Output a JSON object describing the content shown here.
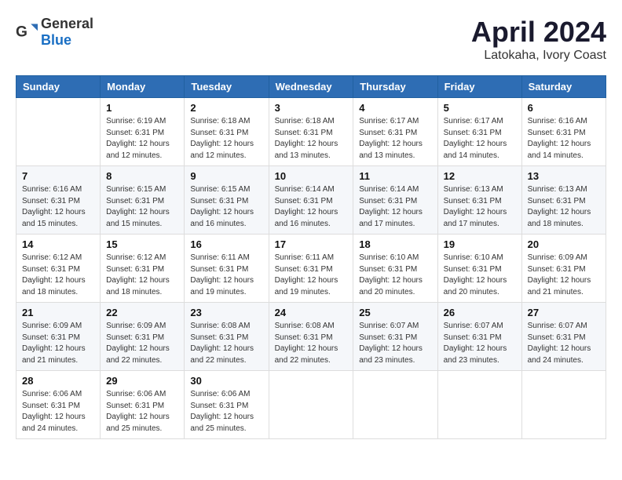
{
  "header": {
    "logo_general": "General",
    "logo_blue": "Blue",
    "month": "April 2024",
    "location": "Latokaha, Ivory Coast"
  },
  "weekdays": [
    "Sunday",
    "Monday",
    "Tuesday",
    "Wednesday",
    "Thursday",
    "Friday",
    "Saturday"
  ],
  "weeks": [
    [
      {
        "day": "",
        "sunrise": "",
        "sunset": "",
        "daylight": ""
      },
      {
        "day": "1",
        "sunrise": "Sunrise: 6:19 AM",
        "sunset": "Sunset: 6:31 PM",
        "daylight": "Daylight: 12 hours and 12 minutes."
      },
      {
        "day": "2",
        "sunrise": "Sunrise: 6:18 AM",
        "sunset": "Sunset: 6:31 PM",
        "daylight": "Daylight: 12 hours and 12 minutes."
      },
      {
        "day": "3",
        "sunrise": "Sunrise: 6:18 AM",
        "sunset": "Sunset: 6:31 PM",
        "daylight": "Daylight: 12 hours and 13 minutes."
      },
      {
        "day": "4",
        "sunrise": "Sunrise: 6:17 AM",
        "sunset": "Sunset: 6:31 PM",
        "daylight": "Daylight: 12 hours and 13 minutes."
      },
      {
        "day": "5",
        "sunrise": "Sunrise: 6:17 AM",
        "sunset": "Sunset: 6:31 PM",
        "daylight": "Daylight: 12 hours and 14 minutes."
      },
      {
        "day": "6",
        "sunrise": "Sunrise: 6:16 AM",
        "sunset": "Sunset: 6:31 PM",
        "daylight": "Daylight: 12 hours and 14 minutes."
      }
    ],
    [
      {
        "day": "7",
        "sunrise": "Sunrise: 6:16 AM",
        "sunset": "Sunset: 6:31 PM",
        "daylight": "Daylight: 12 hours and 15 minutes."
      },
      {
        "day": "8",
        "sunrise": "Sunrise: 6:15 AM",
        "sunset": "Sunset: 6:31 PM",
        "daylight": "Daylight: 12 hours and 15 minutes."
      },
      {
        "day": "9",
        "sunrise": "Sunrise: 6:15 AM",
        "sunset": "Sunset: 6:31 PM",
        "daylight": "Daylight: 12 hours and 16 minutes."
      },
      {
        "day": "10",
        "sunrise": "Sunrise: 6:14 AM",
        "sunset": "Sunset: 6:31 PM",
        "daylight": "Daylight: 12 hours and 16 minutes."
      },
      {
        "day": "11",
        "sunrise": "Sunrise: 6:14 AM",
        "sunset": "Sunset: 6:31 PM",
        "daylight": "Daylight: 12 hours and 17 minutes."
      },
      {
        "day": "12",
        "sunrise": "Sunrise: 6:13 AM",
        "sunset": "Sunset: 6:31 PM",
        "daylight": "Daylight: 12 hours and 17 minutes."
      },
      {
        "day": "13",
        "sunrise": "Sunrise: 6:13 AM",
        "sunset": "Sunset: 6:31 PM",
        "daylight": "Daylight: 12 hours and 18 minutes."
      }
    ],
    [
      {
        "day": "14",
        "sunrise": "Sunrise: 6:12 AM",
        "sunset": "Sunset: 6:31 PM",
        "daylight": "Daylight: 12 hours and 18 minutes."
      },
      {
        "day": "15",
        "sunrise": "Sunrise: 6:12 AM",
        "sunset": "Sunset: 6:31 PM",
        "daylight": "Daylight: 12 hours and 18 minutes."
      },
      {
        "day": "16",
        "sunrise": "Sunrise: 6:11 AM",
        "sunset": "Sunset: 6:31 PM",
        "daylight": "Daylight: 12 hours and 19 minutes."
      },
      {
        "day": "17",
        "sunrise": "Sunrise: 6:11 AM",
        "sunset": "Sunset: 6:31 PM",
        "daylight": "Daylight: 12 hours and 19 minutes."
      },
      {
        "day": "18",
        "sunrise": "Sunrise: 6:10 AM",
        "sunset": "Sunset: 6:31 PM",
        "daylight": "Daylight: 12 hours and 20 minutes."
      },
      {
        "day": "19",
        "sunrise": "Sunrise: 6:10 AM",
        "sunset": "Sunset: 6:31 PM",
        "daylight": "Daylight: 12 hours and 20 minutes."
      },
      {
        "day": "20",
        "sunrise": "Sunrise: 6:09 AM",
        "sunset": "Sunset: 6:31 PM",
        "daylight": "Daylight: 12 hours and 21 minutes."
      }
    ],
    [
      {
        "day": "21",
        "sunrise": "Sunrise: 6:09 AM",
        "sunset": "Sunset: 6:31 PM",
        "daylight": "Daylight: 12 hours and 21 minutes."
      },
      {
        "day": "22",
        "sunrise": "Sunrise: 6:09 AM",
        "sunset": "Sunset: 6:31 PM",
        "daylight": "Daylight: 12 hours and 22 minutes."
      },
      {
        "day": "23",
        "sunrise": "Sunrise: 6:08 AM",
        "sunset": "Sunset: 6:31 PM",
        "daylight": "Daylight: 12 hours and 22 minutes."
      },
      {
        "day": "24",
        "sunrise": "Sunrise: 6:08 AM",
        "sunset": "Sunset: 6:31 PM",
        "daylight": "Daylight: 12 hours and 22 minutes."
      },
      {
        "day": "25",
        "sunrise": "Sunrise: 6:07 AM",
        "sunset": "Sunset: 6:31 PM",
        "daylight": "Daylight: 12 hours and 23 minutes."
      },
      {
        "day": "26",
        "sunrise": "Sunrise: 6:07 AM",
        "sunset": "Sunset: 6:31 PM",
        "daylight": "Daylight: 12 hours and 23 minutes."
      },
      {
        "day": "27",
        "sunrise": "Sunrise: 6:07 AM",
        "sunset": "Sunset: 6:31 PM",
        "daylight": "Daylight: 12 hours and 24 minutes."
      }
    ],
    [
      {
        "day": "28",
        "sunrise": "Sunrise: 6:06 AM",
        "sunset": "Sunset: 6:31 PM",
        "daylight": "Daylight: 12 hours and 24 minutes."
      },
      {
        "day": "29",
        "sunrise": "Sunrise: 6:06 AM",
        "sunset": "Sunset: 6:31 PM",
        "daylight": "Daylight: 12 hours and 25 minutes."
      },
      {
        "day": "30",
        "sunrise": "Sunrise: 6:06 AM",
        "sunset": "Sunset: 6:31 PM",
        "daylight": "Daylight: 12 hours and 25 minutes."
      },
      {
        "day": "",
        "sunrise": "",
        "sunset": "",
        "daylight": ""
      },
      {
        "day": "",
        "sunrise": "",
        "sunset": "",
        "daylight": ""
      },
      {
        "day": "",
        "sunrise": "",
        "sunset": "",
        "daylight": ""
      },
      {
        "day": "",
        "sunrise": "",
        "sunset": "",
        "daylight": ""
      }
    ]
  ]
}
